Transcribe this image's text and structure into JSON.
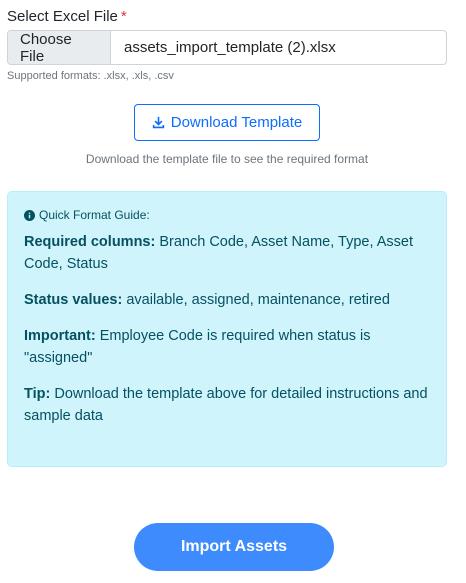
{
  "form": {
    "file_label": "Select Excel File",
    "required_mark": "*",
    "choose_button": "Choose File",
    "file_name": "assets_import_template (2).xlsx",
    "formats_hint": "Supported formats: .xlsx, .xls, .csv"
  },
  "download": {
    "button_label": "Download Template",
    "caption": "Download the template file to see the required format"
  },
  "guide": {
    "title": "Quick Format Guide:",
    "items": [
      {
        "label": "Required columns:",
        "text": " Branch Code, Asset Name, Type, Asset Code, Status"
      },
      {
        "label": "Status values:",
        "text": " available, assigned, maintenance, retired"
      },
      {
        "label": "Important:",
        "text": " Employee Code is required when status is \"assigned\""
      },
      {
        "label": "Tip:",
        "text": " Download the template above for detailed instructions and sample data"
      }
    ]
  },
  "actions": {
    "import_label": "Import Assets"
  },
  "colors": {
    "primary": "#0d6efd",
    "import_button": "#3d8bfd",
    "info_bg": "#cff4fc",
    "info_text": "#055160",
    "required": "#dc3545"
  }
}
